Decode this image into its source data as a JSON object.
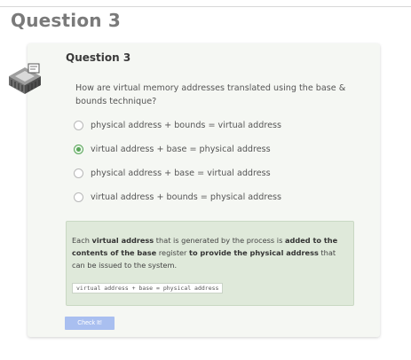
{
  "page": {
    "title": "Question 3"
  },
  "question": {
    "heading": "Question 3",
    "prompt": "How are virtual memory addresses translated using the base & bounds technique?",
    "icon": "cpu-chip-icon",
    "options": [
      {
        "label": "physical address + bounds = virtual address",
        "selected": false
      },
      {
        "label": "virtual address + base = physical address",
        "selected": true
      },
      {
        "label": "physical address + base = virtual address",
        "selected": false
      },
      {
        "label": "virtual address + bounds = physical address",
        "selected": false
      }
    ]
  },
  "feedback": {
    "t1": "Each ",
    "b1": "virtual address",
    "t2": " that is generated by the process is ",
    "b2": "added to the contents of the base",
    "t3": " register ",
    "b3": "to provide the physical address",
    "t4": " that can be issued to the system.",
    "code": "virtual address + base = physical address"
  },
  "actions": {
    "check_label": "Check It!"
  },
  "colors": {
    "accent_green": "#5aa65a",
    "feedback_bg": "#dfe9da",
    "button_bg": "#a9bff0"
  }
}
